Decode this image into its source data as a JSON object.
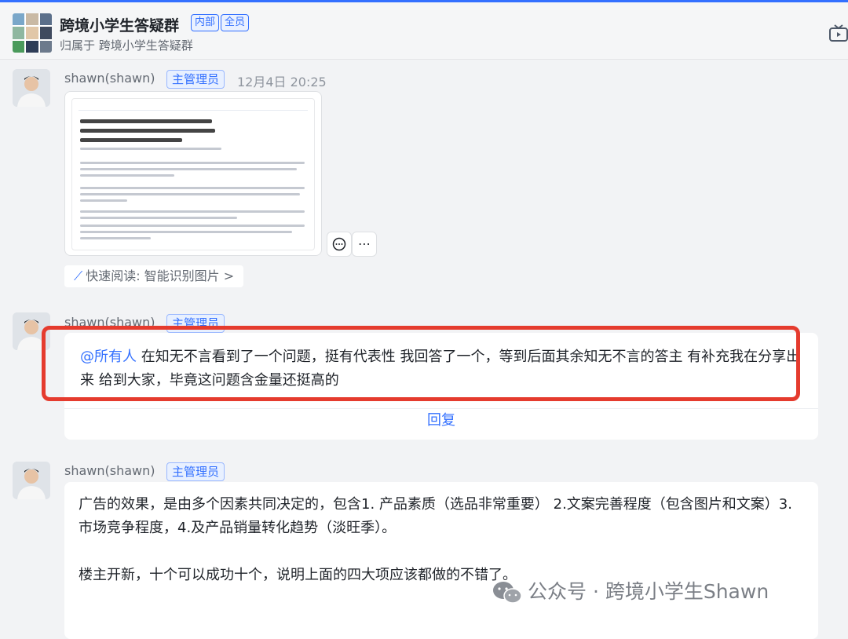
{
  "header": {
    "title": "跨境小学生答疑群",
    "tag_internal": "内部",
    "tag_all": "全员",
    "subtitle": "归属于 跨境小学生答疑群"
  },
  "messages": [
    {
      "sender": "shawn(shawn)",
      "role": "主管理员",
      "time": "12月4日 20:25",
      "quick_read": "快速阅读: 智能识别图片 >"
    },
    {
      "sender": "shawn(shawn)",
      "role": "主管理员",
      "mention": "@所有人",
      "text": "在知无不言看到了一个问题，挺有代表性 我回答了一个，等到后面其余知无不言的答主 有补充我在分享出来 给到大家，毕竟这问题含金量还挺高的",
      "reply_label": "回复"
    },
    {
      "sender": "shawn(shawn)",
      "role": "主管理员",
      "paragraph1": "广告的效果，是由多个因素共同决定的，包含1. 产品素质（选品非常重要） 2.文案完善程度（包含图片和文案）3.市场竞争程度，4.及产品销量转化趋势（淡旺季）。",
      "paragraph2": "楼主开新，十个可以成功十个，说明上面的四大项应该都做的不错了。"
    }
  ],
  "watermark": "公众号 · 跨境小学生Shawn",
  "colors": {
    "accent": "#3370ff",
    "highlight": "#e53b2e"
  }
}
